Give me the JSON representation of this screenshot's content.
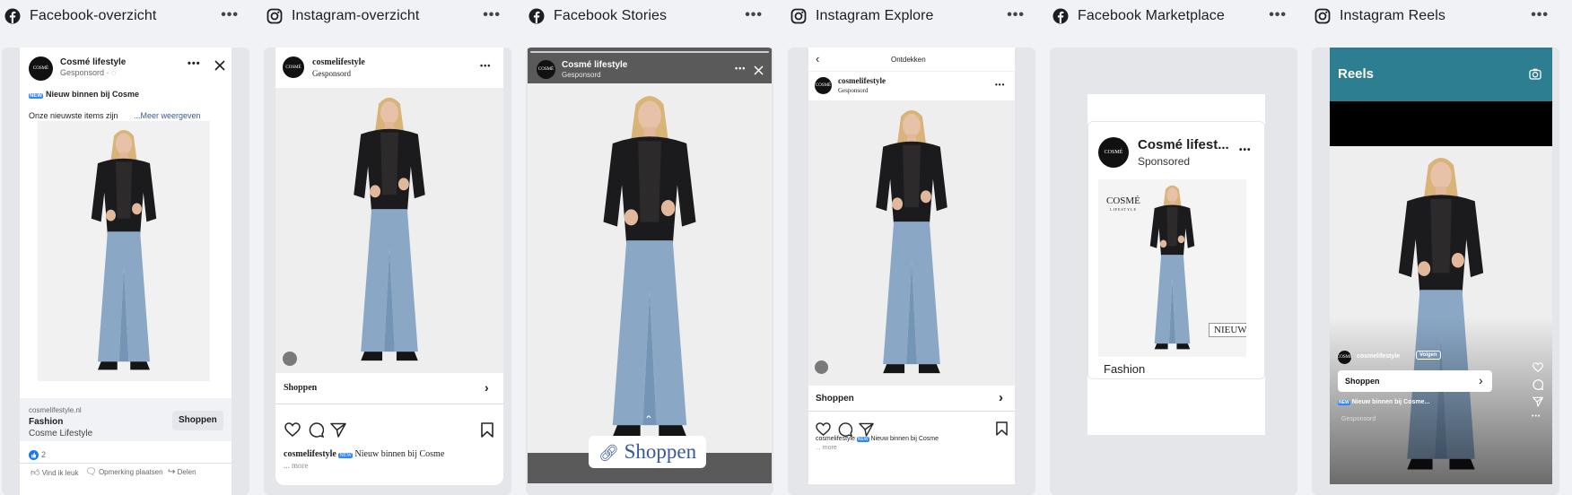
{
  "columns": [
    {
      "title": "Facebook-overzicht",
      "platform_icon": "facebook-icon"
    },
    {
      "title": "Instagram-overzicht",
      "platform_icon": "instagram-icon"
    },
    {
      "title": "Facebook Stories",
      "platform_icon": "facebook-icon"
    },
    {
      "title": "Instagram Explore",
      "platform_icon": "instagram-icon"
    },
    {
      "title": "Facebook Marketplace",
      "platform_icon": "facebook-icon"
    },
    {
      "title": "Instagram Reels",
      "platform_icon": "instagram-icon"
    }
  ],
  "more_glyph": "•••",
  "brand": {
    "logo_text": "COSMÉ",
    "logo_sub": "LIFESTYLE"
  },
  "fb_feed": {
    "page_name": "Cosmé lifestyle",
    "sponsored": "Gesponsord · ",
    "headline": "Nieuw binnen bij Cosme",
    "headline_badge": "🆕",
    "body": "Onze nieuwste items zijn",
    "see_more": "...Meer weergeven",
    "link_domain": "cosmelifestyle.nl",
    "link_title": "Fashion",
    "link_desc": "Cosme Lifestyle",
    "cta": "Shoppen",
    "reactions_count": "2",
    "like": "Vind ik leuk",
    "comment": "Opmerking plaatsen",
    "share": "Delen"
  },
  "ig_feed": {
    "username": "cosmelifestyle",
    "sponsored": "Gesponsord",
    "cta": "Shoppen",
    "caption_user": "cosmelifestyle",
    "caption_text": "Nieuw binnen bij Cosme",
    "caption_badge": "🆕",
    "more": "... more"
  },
  "fb_story": {
    "page_name": "Cosmé lifestyle",
    "sponsored": "Gesponsord",
    "cta": "Shoppen"
  },
  "ig_explore": {
    "header": "Ontdekken",
    "username": "cosmelifestyle",
    "sponsored": "Gesponsord",
    "cta": "Shoppen",
    "caption_user": "cosmelifestyle",
    "caption_text": "Nieuw binnen bij Cosme",
    "caption_badge": "🆕",
    "more": "... more"
  },
  "marketplace": {
    "page_name": "Cosmé lifest...",
    "sponsored": "Sponsored",
    "logo_text": "COSMÉ",
    "logo_sub": "LIFESTYLE",
    "sticker": "NIEUW",
    "caption": "Fashion"
  },
  "reels": {
    "title": "Reels",
    "username": "cosmelifestyle",
    "follow": "Volgen",
    "cta": "Shoppen",
    "caption": "Nieuw binnen bij Cosme...",
    "caption_badge": "🆕",
    "sponsored": "Gesponsord"
  },
  "colors": {
    "facebook_blue": "#1877f2",
    "link_blue": "#385898",
    "reels_header": "#2e7e92",
    "story_bar": "#5a5a5a"
  }
}
